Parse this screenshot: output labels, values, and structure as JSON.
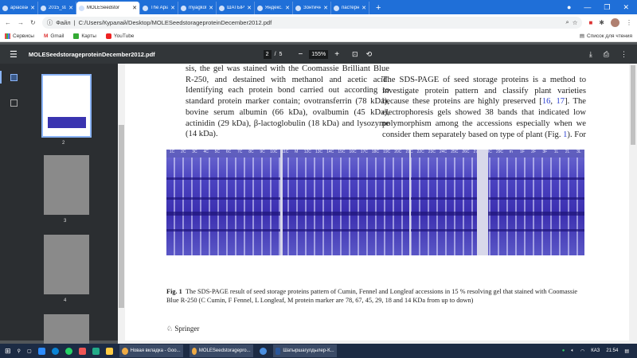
{
  "browser": {
    "tabs": [
      {
        "label": "apiaceae fami",
        "active": false
      },
      {
        "label": "2015_stati#08",
        "active": false
      },
      {
        "label": "MOLESeedstor",
        "active": true
      },
      {
        "label": "The Apiaceae",
        "active": false
      },
      {
        "label": "myagkolucher",
        "active": false
      },
      {
        "label": "ШАТЫРШАГУ",
        "active": false
      },
      {
        "label": "Яндекс.Перев",
        "active": false
      },
      {
        "label": "Зонтичные —",
        "active": false
      },
      {
        "label": "пастернак ово",
        "active": false
      }
    ],
    "url_prefix": "Файл",
    "url": "C:/Users/Куралай/Desktop/MOLESeedstorageproteinDecember2012.pdf",
    "bookmarks": [
      "Сервисы",
      "Gmail",
      "Карты",
      "YouTube"
    ],
    "reading_list": "Список для чтения"
  },
  "pdf": {
    "title": "MOLESeedstorageproteinDecember2012.pdf",
    "current_page": "2",
    "total_pages": "5",
    "zoom": "155%",
    "thumbnails": [
      "2",
      "3",
      "4"
    ]
  },
  "page": {
    "left_col": "sis, the gel was stained with the Coomassie Brilliant Blue R-250, and destained with methanol and acetic acid. Identifying each protein bond carried out according to standard protein marker contain; ovotransferrin (78 kDa), bovine serum albumin (66 kDa), ovalbumin (45 kDa), actinidin (29 kDa), β-lactoglobulin (18 kDa) and lysozyme (14 kDa).",
    "right_col_a": "The SDS-PAGE of seed storage proteins is a method to investigate protein pattern and classify plant varieties because these proteins are highly preserved [",
    "ref1": "16",
    "ref2": "17",
    "right_col_b": "]. The electrophoresis gels showed 38 bands that indicated low polymorphism among the accessions especially when we consider them separately based on type of plant (Fig. ",
    "fig_ref": "1",
    "right_col_c": "). For",
    "lanes": [
      "1C",
      "2C",
      "3C",
      "4C",
      "5C",
      "6C",
      "7C",
      "8C",
      "9C",
      "10C",
      "11C",
      "M",
      "12C",
      "13C",
      "14C",
      "15C",
      "16C",
      "17C",
      "18C",
      "19C",
      "20C",
      "21C",
      "22C",
      "23C",
      "24C",
      "25C",
      "26C",
      "27C",
      "28C",
      "29C",
      "m",
      "1F",
      "2F",
      "3F",
      "1L",
      "2L",
      "3L"
    ],
    "caption_label": "Fig. 1",
    "caption": "The SDS-PAGE result of seed storage proteins pattern of Cumin, Fennel and Longleaf accessions in 15 % resolving gel that stained with Coomassie Blue R-250 (C Cumin, F Fennel, L Longleaf, M protein marker are 78, 67, 45, 29, 18 and 14 KDa from up to down)",
    "publisher": "Springer"
  },
  "taskbar": {
    "apps": [
      "Новая вкладка - Goo...",
      "MOLESeedstoragepro...",
      "Шатыршагулдылер-К..."
    ],
    "lang": "КАЗ",
    "time": "21:54"
  }
}
